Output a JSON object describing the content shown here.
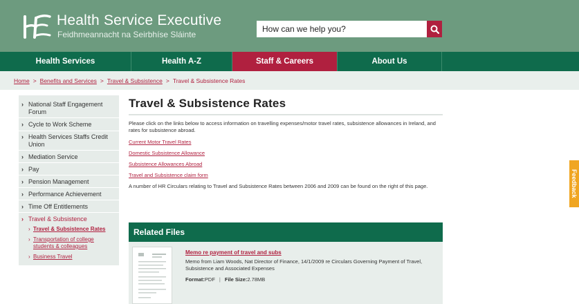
{
  "header": {
    "title": "Health Service Executive",
    "subtitle": "Feidhmeannacht na Seirbhíse Sláinte",
    "search_placeholder": "How can we help you?"
  },
  "nav": {
    "items": [
      {
        "label": "Health Services"
      },
      {
        "label": "Health A-Z"
      },
      {
        "label": "Staff & Careers",
        "active": true
      },
      {
        "label": "About Us"
      }
    ]
  },
  "breadcrumb": [
    "Home",
    "Benefits and Services",
    "Travel & Subsistence",
    "Travel & Subsistence Rates"
  ],
  "sidebar": {
    "items": [
      {
        "label": "National Staff Engagement Forum"
      },
      {
        "label": "Cycle to Work Scheme"
      },
      {
        "label": "Health Services Staffs Credit Union"
      },
      {
        "label": "Mediation Service"
      },
      {
        "label": "Pay"
      },
      {
        "label": "Pension Management"
      },
      {
        "label": "Performance Achievement"
      },
      {
        "label": "Time Off Entitlements"
      },
      {
        "label": "Travel & Subsistence",
        "active": true
      }
    ],
    "sub_items": [
      {
        "label": "Travel & Subsistence Rates",
        "current": true
      },
      {
        "label": "Transportation of college students & colleagues"
      },
      {
        "label": "Business Travel"
      }
    ]
  },
  "main": {
    "title": "Travel & Subsistence Rates",
    "intro": "Please click on the links below to access information on travelling expenses/motor travel rates, subsistence allowances in Ireland, and rates for subsistence abroad.",
    "links": [
      "Current Motor Travel Rates",
      "Domestic Subsistence Allowance",
      "Subsistence Allowances Abroad",
      "Travel and Subsistence claim form"
    ],
    "circulars_note": "A number of HR Circulars relating to Travel and Subsistence Rates between 2006 and 2009 can be found on the right of this page."
  },
  "related_files": {
    "heading": "Related Files",
    "file": {
      "title": "Memo re payment of travel and subs",
      "description": "Memo from Liam Woods, Nat Director of Finance, 14/1/2009 re Circulars Governing Payment of Travel, Subsistence and Associated Expenses",
      "format_label": "Format:",
      "format": "PDF",
      "size_label": "File Size:",
      "size": "2.78MB"
    }
  },
  "feedback": {
    "label": "Feedback"
  },
  "colors": {
    "header_green": "#6d9b7f",
    "nav_green": "#0f6b4c",
    "accent_red": "#b0203f",
    "feedback_orange": "#f0a622"
  },
  "icons": {
    "logo": "hse-logo-icon",
    "search": "search-icon",
    "chevron": "chevron-right-icon"
  }
}
